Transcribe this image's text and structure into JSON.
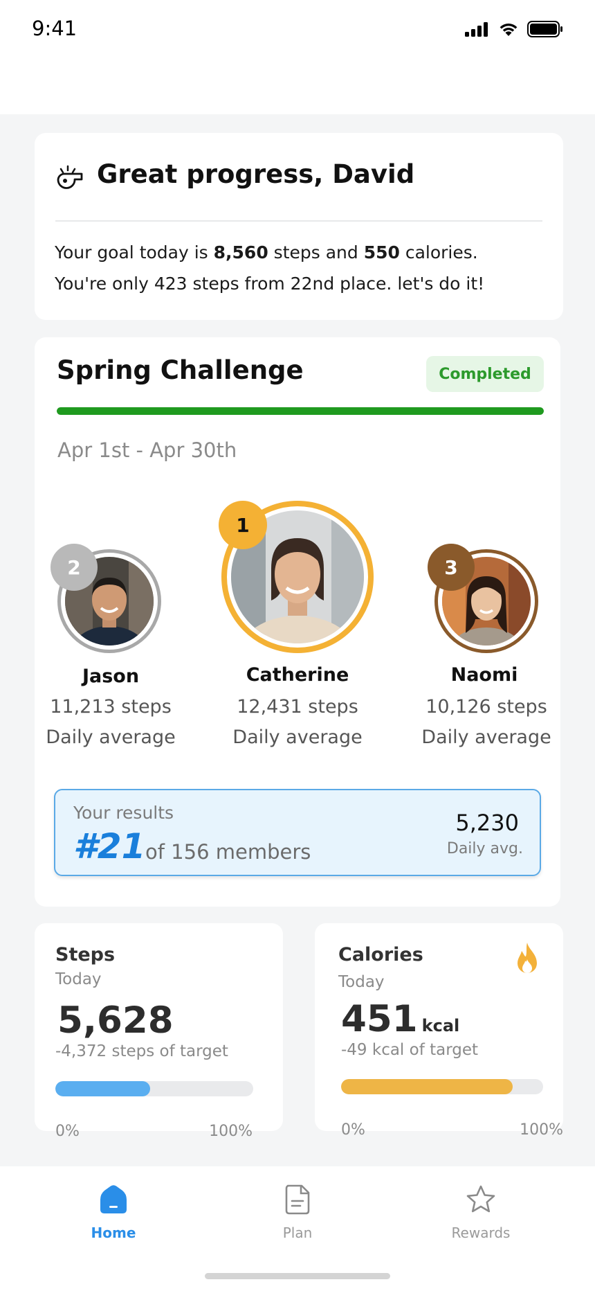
{
  "status_bar": {
    "time": "9:41"
  },
  "greeting": {
    "title": "Great progress, David",
    "line1_prefix": "Your goal today is ",
    "goal_steps": "8,560",
    "line1_mid": " steps and ",
    "goal_calories": "550",
    "line1_suffix": " calories.",
    "line2": "You're only 423 steps from 22nd place. let's do it!"
  },
  "challenge": {
    "title": "Spring Challenge",
    "status": "Completed",
    "progress_fraction": 1.0,
    "dates": "Apr 1st - Apr 30th",
    "leaders": [
      {
        "rank": "2",
        "name": "Jason",
        "steps": "11,213 steps",
        "sub": "Daily average"
      },
      {
        "rank": "1",
        "name": "Catherine",
        "steps": "12,431 steps",
        "sub": "Daily average"
      },
      {
        "rank": "3",
        "name": "Naomi",
        "steps": "10,126 steps",
        "sub": "Daily average"
      }
    ],
    "results": {
      "label": "Your results",
      "rank": "#21",
      "of_members": "of 156 members",
      "value": "5,230",
      "value_label": "Daily avg."
    }
  },
  "steps_card": {
    "title": "Steps",
    "subtitle": "Today",
    "value": "5,628",
    "note": "-4,372 steps of target",
    "progress_fraction": 0.48,
    "min_label": "0%",
    "max_label": "100%",
    "color": "#5aaef0"
  },
  "calories_card": {
    "title": "Calories",
    "subtitle": "Today",
    "value": "451",
    "unit": "kcal",
    "note": "-49 kcal of target",
    "progress_fraction": 0.85,
    "min_label": "0%",
    "max_label": "100%",
    "color": "#eeb546"
  },
  "tabbar": {
    "tabs": [
      {
        "label": "Home",
        "icon": "home-icon",
        "active": true
      },
      {
        "label": "Plan",
        "icon": "document-icon",
        "active": false
      },
      {
        "label": "Rewards",
        "icon": "star-icon",
        "active": false
      }
    ],
    "active_color": "#2a8ee8",
    "inactive_color": "#9a9a9a"
  }
}
